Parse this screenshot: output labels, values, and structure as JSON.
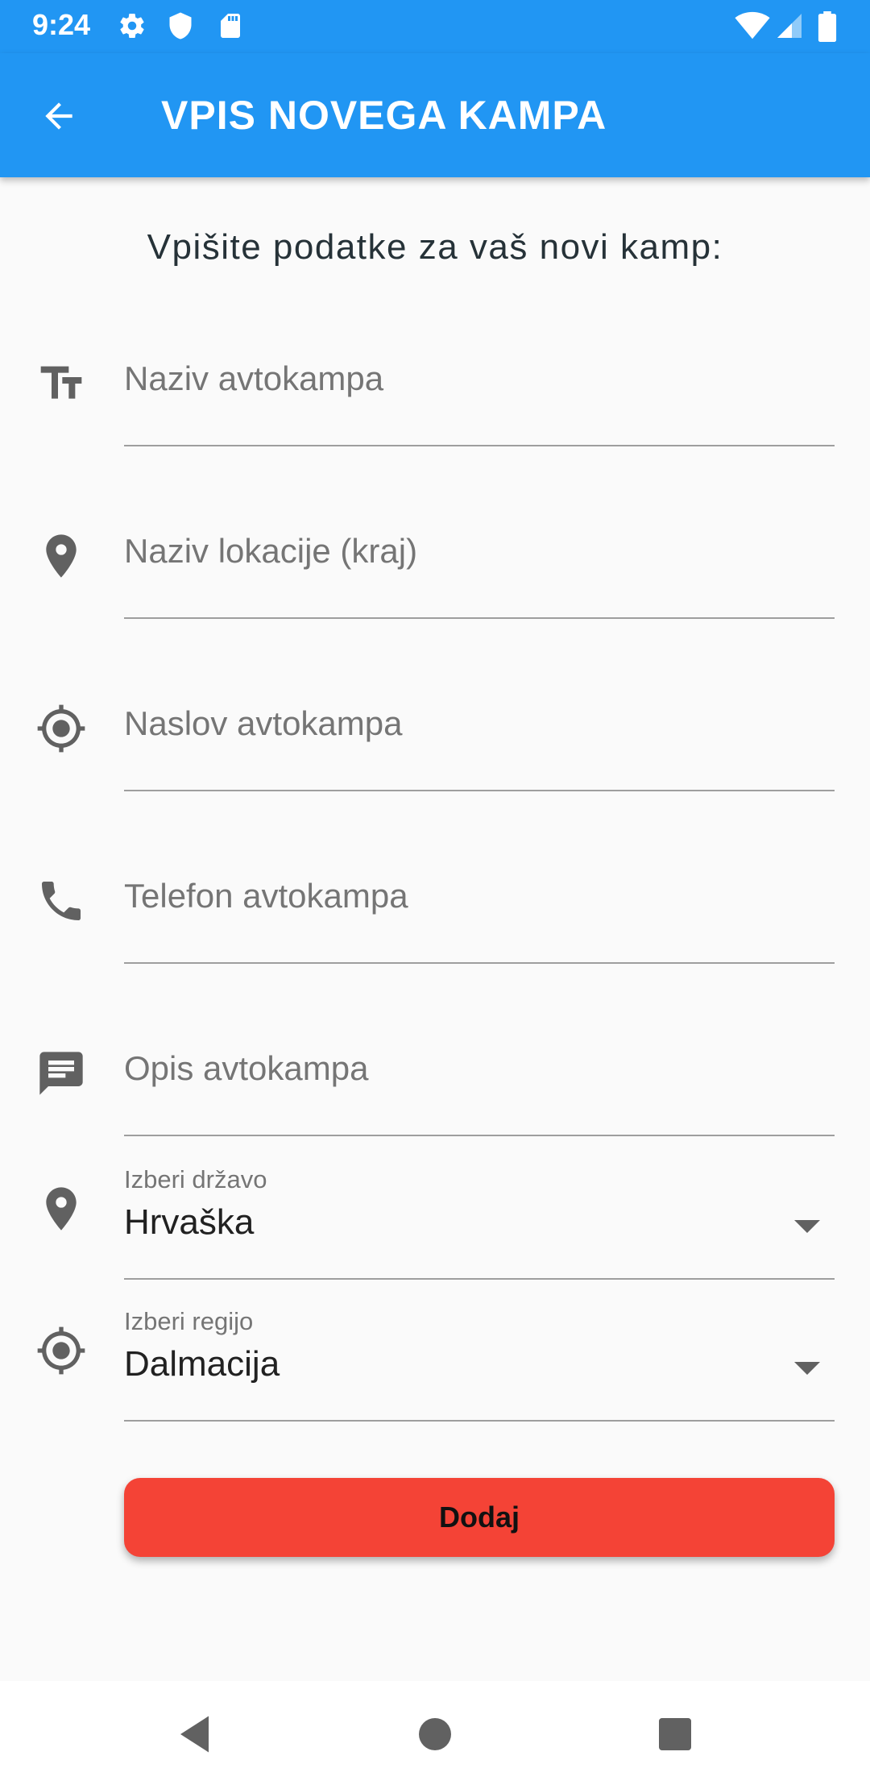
{
  "status_bar": {
    "time": "9:24",
    "icons": [
      "settings-icon",
      "shield-icon",
      "sd-card-icon",
      "wifi-icon",
      "signal-icon",
      "battery-icon"
    ]
  },
  "app_bar": {
    "title": "VPIS NOVEGA KAMPA",
    "back_icon": "arrow-back-icon",
    "color": "#2196f3"
  },
  "intro": "Vpišite podatke za vaš novi kamp:",
  "form": {
    "fields": [
      {
        "icon": "text-fields-icon",
        "placeholder": "Naziv avtokampa",
        "value": ""
      },
      {
        "icon": "location-pin-icon",
        "placeholder": "Naziv lokacije (kraj)",
        "value": ""
      },
      {
        "icon": "gps-target-icon",
        "placeholder": "Naslov avtokampa",
        "value": ""
      },
      {
        "icon": "phone-icon",
        "placeholder": "Telefon avtokampa",
        "value": ""
      },
      {
        "icon": "message-icon",
        "placeholder": "Opis avtokampa",
        "value": ""
      }
    ],
    "country_select": {
      "icon": "location-pin-icon",
      "label": "Izberi državo",
      "value": "Hrvaška"
    },
    "region_select": {
      "icon": "gps-target-icon",
      "label": "Izberi regijo",
      "value": "Dalmacija"
    },
    "submit_label": "Dodaj",
    "submit_color": "#f44336"
  },
  "nav_bar": {
    "icons": [
      "back-triangle-icon",
      "home-circle-icon",
      "recents-square-icon"
    ]
  }
}
